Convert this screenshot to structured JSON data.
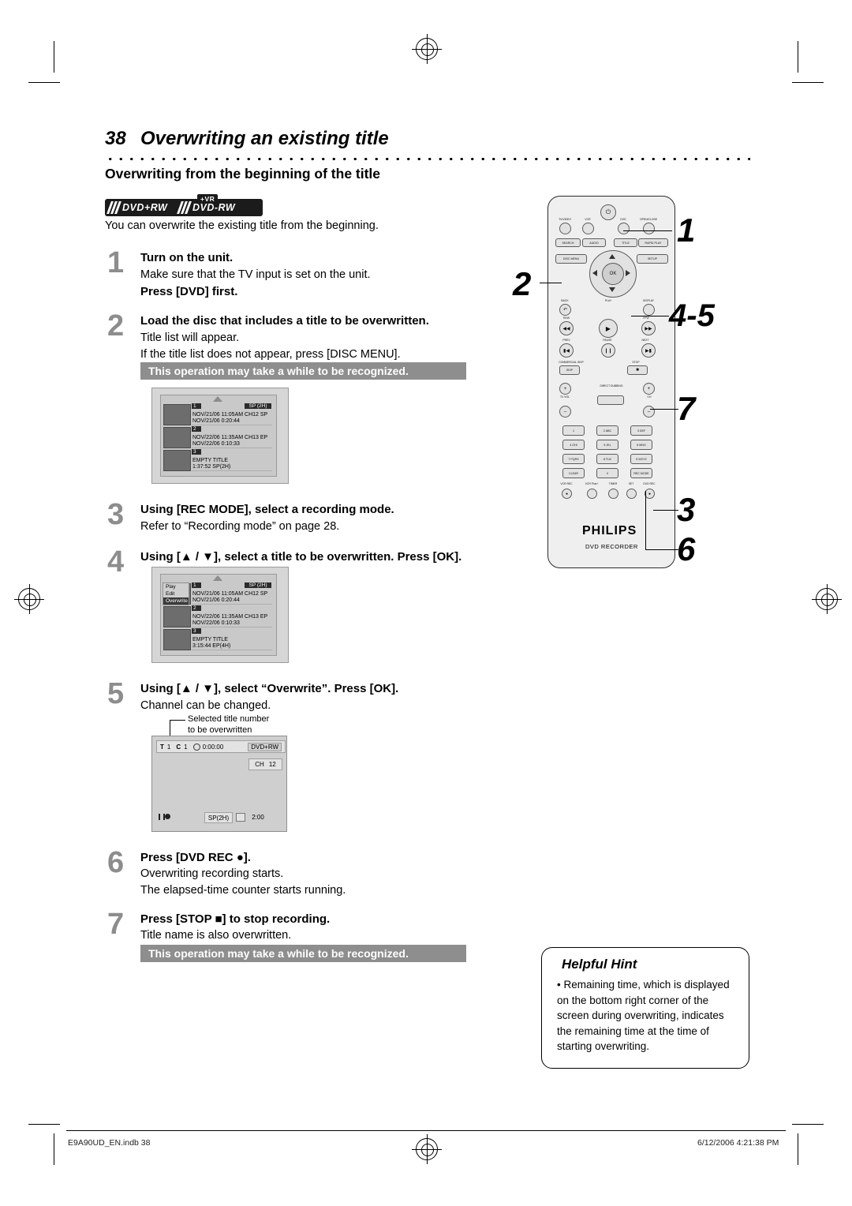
{
  "page": {
    "number": "38",
    "title": "Overwriting an existing title",
    "subtitle": "Overwriting from the beginning of the title",
    "intro": "You can overwrite the existing title from the beginning.",
    "logos": [
      {
        "label": "DVD+RW",
        "badge": ""
      },
      {
        "label": "DVD-RW",
        "badge": "+VR"
      }
    ]
  },
  "steps": [
    {
      "num": "1",
      "bold": "Turn on the unit.",
      "lines": [
        "Make sure that the TV input is set on the unit."
      ],
      "bold2": "Press [DVD] first."
    },
    {
      "num": "2",
      "bold": "Load the disc that includes a title to be overwritten.",
      "lines": [
        "Title list will appear.",
        "If the title list does not appear, press [DISC MENU]."
      ],
      "note": "This operation may take a while to be recognized."
    },
    {
      "num": "3",
      "bold": "Using [REC MODE], select a recording mode.",
      "lines": [
        "Refer to “Recording mode” on page 28."
      ]
    },
    {
      "num": "4",
      "bold": "Using [▲ / ▼], select a title to be overwritten. Press [OK]."
    },
    {
      "num": "5",
      "bold": "Using [▲ / ▼], select “Overwrite”. Press [OK].",
      "lines": [
        "Channel can be changed."
      ]
    },
    {
      "num": "6",
      "bold": "Press [DVD REC ●].",
      "lines": [
        "Overwriting recording starts.",
        "The elapsed-time counter starts running."
      ]
    },
    {
      "num": "7",
      "bold": "Press [STOP ■] to stop recording.",
      "lines": [
        "Title name is also overwritten."
      ],
      "note": "This operation may take a while to be recognized."
    }
  ],
  "title_list_1": {
    "rec_mode": "SP (2H)",
    "entries": [
      {
        "n": "1",
        "line1": "NOV/21/06  11:05AM CH12  SP",
        "line2": "NOV/21/06   0:20:44"
      },
      {
        "n": "2",
        "line1": "NOV/22/06  11:35AM CH13  EP",
        "line2": "NOV/22/06   0:10:33"
      },
      {
        "n": "3",
        "line1": "EMPTY TITLE",
        "line2": "1:37:52  SP(2H)"
      }
    ]
  },
  "title_list_2": {
    "rec_mode": "SP (2H)",
    "menu": [
      "Play",
      "Edit",
      "Overwrite"
    ],
    "menu_selected": "Overwrite",
    "entries": [
      {
        "n": "1",
        "line1": "NOV/21/06  11:05AM CH12  SP",
        "line2": "NOV/21/06   0:20:44"
      },
      {
        "n": "2",
        "line1": "NOV/22/06  11:35AM CH13  EP",
        "line2": "NOV/22/06   0:10:33"
      },
      {
        "n": "3",
        "line1": "EMPTY TITLE",
        "line2": "3:15:44  EP(4H)"
      }
    ]
  },
  "callout": {
    "line1": "Selected title number",
    "line2": "to be overwritten"
  },
  "osd": {
    "title_label": "T",
    "title_num": "1",
    "chapter_label": "C",
    "chapter_num": "1",
    "timer": "0:00:00",
    "disc": "DVD+RW",
    "channel_label": "CH",
    "channel_num": "12",
    "rec_mode": "SP(2H)",
    "remaining": "2:00"
  },
  "remote": {
    "brand": "PHILIPS",
    "model": "DVD RECORDER",
    "callouts": [
      "1",
      "2",
      "4-5",
      "7",
      "3",
      "6"
    ],
    "buttons": [
      {
        "label": "TV/VIDEO"
      },
      {
        "label": "VCR"
      },
      {
        "label": "DVD"
      },
      {
        "label": "OPEN/CLOSE"
      },
      {
        "label": "SEARCH"
      },
      {
        "label": "AUDIO"
      },
      {
        "label": "TITLE"
      },
      {
        "label": "RAPID PLAY"
      },
      {
        "label": "DISC MENU"
      },
      {
        "label": "SETUP"
      },
      {
        "label": "OK"
      },
      {
        "label": "BACK"
      },
      {
        "label": "DISPLAY"
      },
      {
        "label": "REW"
      },
      {
        "label": "PLAY"
      },
      {
        "label": "FFW"
      },
      {
        "label": "PREV"
      },
      {
        "label": "PAUSE"
      },
      {
        "label": "NEXT"
      },
      {
        "label": "COMMERCIAL SKIP"
      },
      {
        "label": "STOP"
      },
      {
        "label": "TV VOL"
      },
      {
        "label": "DIRECT DUBBING"
      },
      {
        "label": "CH"
      },
      {
        "label": "1"
      },
      {
        "label": "2  ABC"
      },
      {
        "label": "3  DEF"
      },
      {
        "label": "4  GHI"
      },
      {
        "label": "5  JKL"
      },
      {
        "label": "6  MNO"
      },
      {
        "label": "7  PQRS"
      },
      {
        "label": "8  TUV"
      },
      {
        "label": "9  WXYZ"
      },
      {
        "label": "CLEAR"
      },
      {
        "label": "0"
      },
      {
        "label": "REC MODE"
      },
      {
        "label": "VCR REC"
      },
      {
        "label": "VCR Plus+"
      },
      {
        "label": "TIMER"
      },
      {
        "label": "SET"
      },
      {
        "label": "DVD REC"
      }
    ]
  },
  "hint": {
    "title": "Helpful Hint",
    "body": "• Remaining time, which is displayed on the bottom right corner of the screen during overwriting, indicates the remaining time at the time of starting overwriting."
  },
  "footer": {
    "left": "E9A90UD_EN.indb   38",
    "right": "6/12/2006   4:21:38 PM"
  }
}
